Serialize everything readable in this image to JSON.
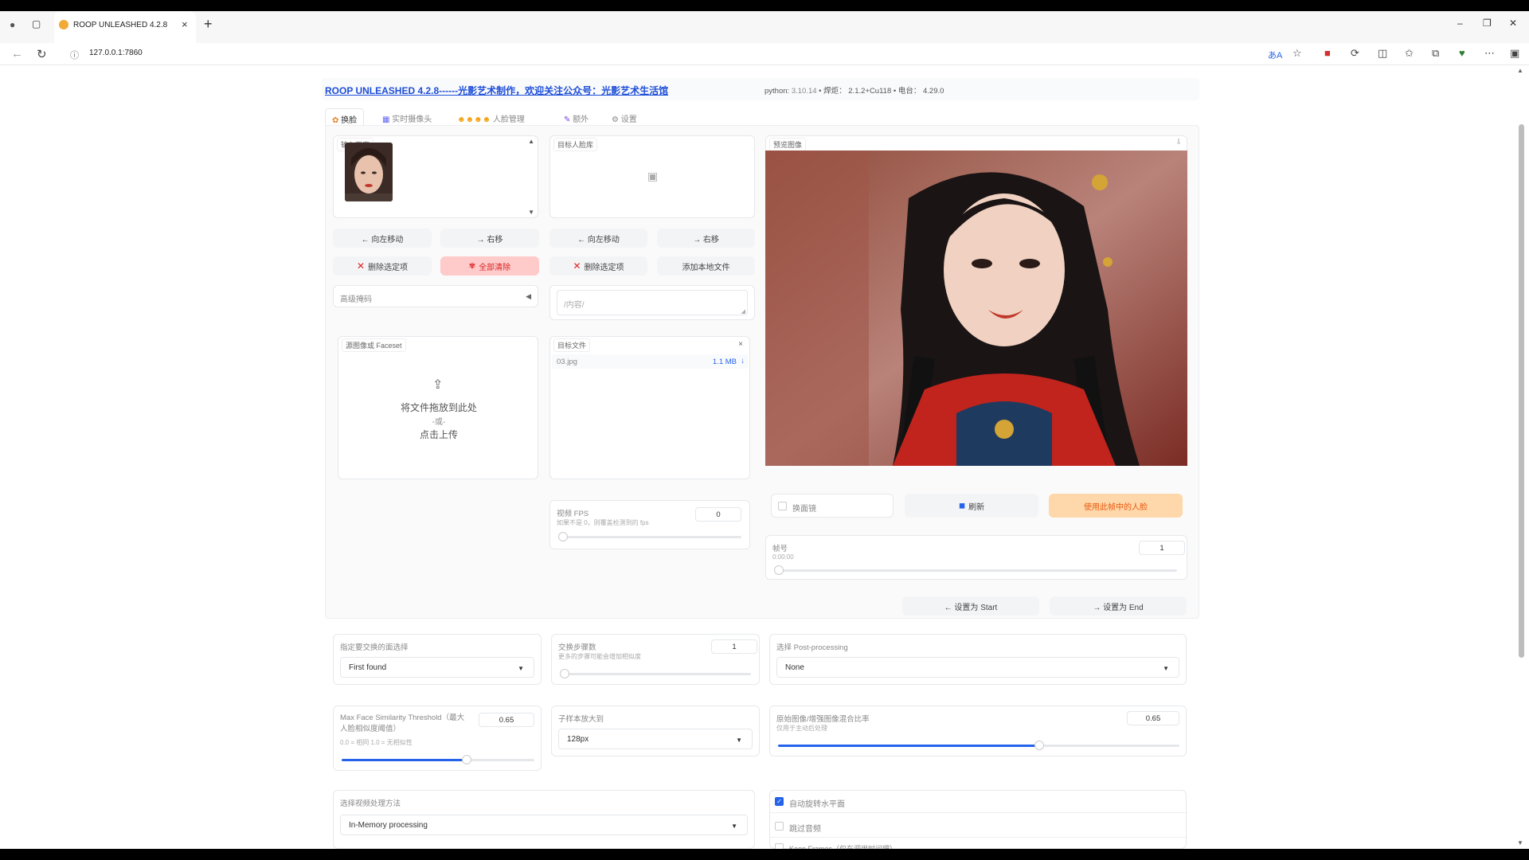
{
  "browser": {
    "tab_title": "ROOP UNLEASHED 4.2.8",
    "url": "127.0.0.1:7860"
  },
  "header": {
    "title": "ROOP UNLEASHED 4.2.8------光影艺术制作，欢迎关注公众号：光影艺术生活馆",
    "python_label": "python:",
    "python_version": "3.10.14",
    "torch_label": "•  焊炬：",
    "torch_version": "2.1.2+Cu118",
    "gradio_label": "•  电台：",
    "gradio_version": "4.29.0"
  },
  "tabs": [
    {
      "label": "换脸"
    },
    {
      "label": "实时摄像头"
    },
    {
      "label": "人脸管理"
    },
    {
      "label": "额外"
    },
    {
      "label": "设置"
    }
  ],
  "input_faces": {
    "label": "输入面库",
    "btn_left": "← 向左移动",
    "btn_right": "→ 右移",
    "btn_delete": "删除选定项",
    "btn_clear_all": "全部清除",
    "mask_label": "高级掩码"
  },
  "target_faces": {
    "label": "目标人脸库",
    "btn_left": "← 向左移动",
    "btn_right": "→ 右移",
    "btn_delete": "删除选定项",
    "btn_add_local": "添加本地文件",
    "textarea_placeholder": "/内容/"
  },
  "source_upload": {
    "label": "源图像或 Faceset",
    "drop_text": "将文件拖放到此处",
    "or_text": "-或-",
    "click_text": "点击上传"
  },
  "target_files": {
    "label": "目标文件",
    "file_name": "03.jpg",
    "file_size": "1.1 MB",
    "download_icon": "↓"
  },
  "preview": {
    "label": "预览图像"
  },
  "video_fps": {
    "label": "视频 FPS",
    "sub": "如果不是 0，则覆盖检测到的 fps",
    "value": "0"
  },
  "preview_controls": {
    "face_swap_label": "换面镜",
    "refresh_label": "刷新",
    "use_face_label": "使用此帧中的人脸"
  },
  "frame": {
    "label": "帧号",
    "time": "0:00:00",
    "value": "1",
    "set_start": "← 设置为 Start",
    "set_end": "→ 设置为 End"
  },
  "face_select": {
    "label": "指定要交换的面选择",
    "value": "First found"
  },
  "swap_steps": {
    "label": "交换步骤数",
    "sub": "更多的步骤可能会增加相似度",
    "value": "1"
  },
  "post_processing": {
    "label": "选择 Post-processing",
    "value": "None"
  },
  "max_similarity": {
    "label": "Max Face Similarity Threshold（最大人脸相似度阈值）",
    "sub": "0.0 = 相同 1.0 = 无相似性",
    "value": "0.65",
    "fraction": 0.65
  },
  "subsample": {
    "label": "子样本放大到",
    "value": "128px"
  },
  "blend_ratio": {
    "label": "原始图像/增强图像混合比率",
    "sub": "仅用于主动后处理",
    "value": "0.65",
    "fraction": 0.65
  },
  "video_processing": {
    "label": "选择视频处理方法",
    "value": "In-Memory processing"
  },
  "options": {
    "auto_rotate": "自动旋转水平面",
    "skip_audio": "跳过音频",
    "keep_frames": "Keep Frames（仅在调用时间理）"
  },
  "colors": {
    "accent": "#2563eb",
    "clear_btn_bg": "#fecaca",
    "use_face_bg": "#fed7aa",
    "link": "#1d4ed8"
  }
}
